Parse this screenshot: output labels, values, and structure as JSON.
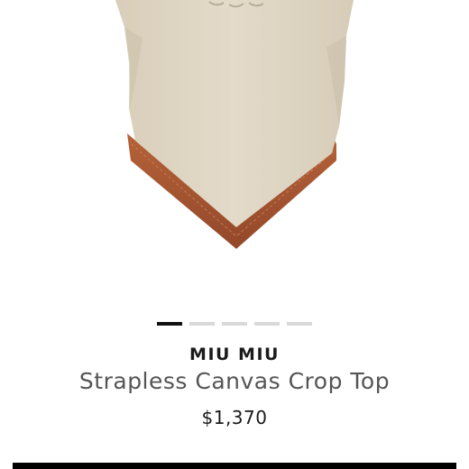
{
  "product": {
    "brand": "MIU MIU",
    "name": "Strapless Canvas Crop Top",
    "price": "$1,370"
  },
  "carousel": {
    "total_images": 5,
    "active_index": 0
  },
  "colors": {
    "canvas": "#ddd3c1",
    "leather_trim": "#a4552c",
    "dot_active": "#111111",
    "dot_inactive": "#d9d9d9",
    "button": "#000000"
  }
}
